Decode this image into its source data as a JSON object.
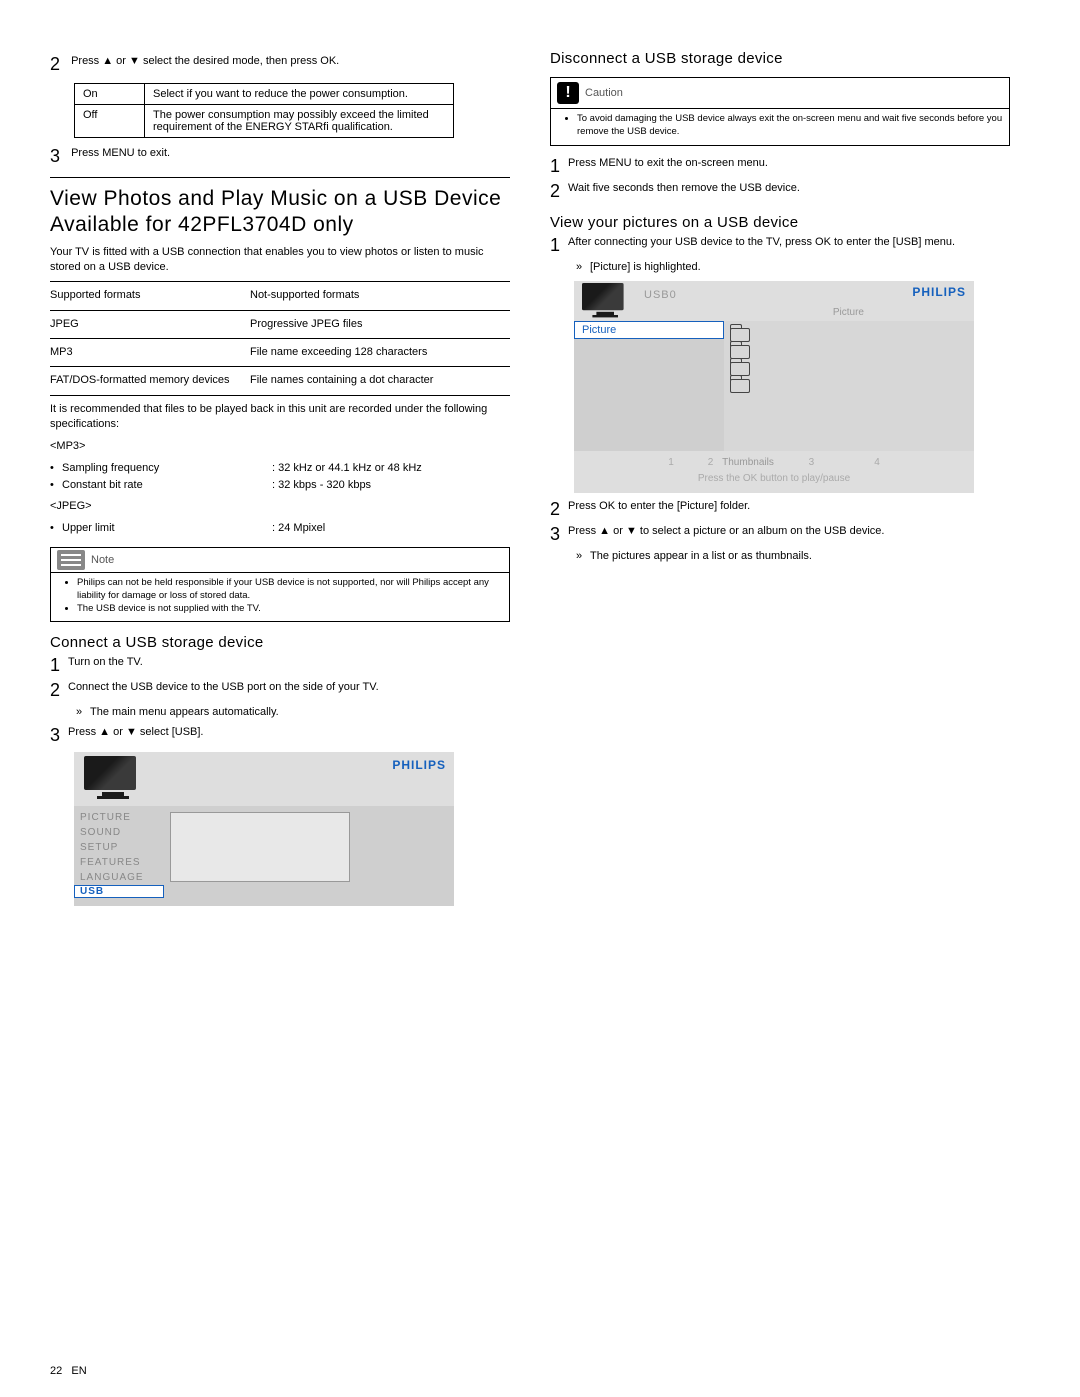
{
  "left": {
    "step2": "Press ▲ or ▼ select the desired mode, then press OK.",
    "table": {
      "r1c1": "On",
      "r1c2": "Select if you want to reduce the power consumption.",
      "r2c1": "Off",
      "r2c2": "The power consumption may possibly exceed the limited requirement of the ENERGY STARfi qualification."
    },
    "step3": "Press MENU to exit.",
    "h2a": "View Photos and Play Music on a USB Device",
    "h2b": "Available for 42PFL3704D only",
    "intro": "Your TV is ﬁtted with a USB connection that enables you to view photos or listen to music stored on a USB device.",
    "fmtHead1": "Supported formats",
    "fmtHead2": "Not-supported formats",
    "fmt1a": "JPEG",
    "fmt1b": "Progressive JPEG ﬁles",
    "fmt2a": "MP3",
    "fmt2b": "File name exceeding 128 characters",
    "fmt3a": "FAT/DOS-formatted memory devices",
    "fmt3b": "File names containing a dot character",
    "reco": "It is recommended that ﬁles to be played back in this unit are recorded under the following speciﬁcations:",
    "mp3": "<MP3>",
    "s1k": "Sampling frequency",
    "s1v": ": 32 kHz or 44.1 kHz or 48 kHz",
    "s2k": "Constant bit rate",
    "s2v": ": 32 kbps - 320 kbps",
    "jpeg": "<JPEG>",
    "s3k": "Upper limit",
    "s3v": ": 24 Mpixel",
    "noteTitle": "Note",
    "noteItem1": "Philips can not be held responsible if your USB device is not supported, nor will Philips accept any liability for damage or loss of stored data.",
    "noteItem2": "The USB device is not supplied with the TV.",
    "connectH": "Connect a USB storage device",
    "c1": "Turn on the TV.",
    "c2": "Connect the USB device to the USB port on the side of your TV.",
    "c2sub": "The main menu appears automatically.",
    "c3": "Press ▲ or ▼ select [USB].",
    "menu": {
      "items": [
        "PICTURE",
        "SOUND",
        "SETUP",
        "FEATURES",
        "LANGUAGE",
        "USB"
      ],
      "logo": "PHILIPS"
    }
  },
  "right": {
    "discH": "Disconnect a USB storage device",
    "cautionTitle": "Caution",
    "cautionBody": "To avoid damaging the USB device always exit the on-screen menu and wait ﬁve seconds before you remove the USB device.",
    "d1": "Press MENU to exit the on-screen menu.",
    "d2": "Wait ﬁve seconds then remove the USB device.",
    "viewH": "View your pictures on a USB device",
    "v1": "After connecting your USB device to the TV, press OK to enter the [USB] menu.",
    "v1sub": "[Picture] is highlighted.",
    "usb": {
      "title": "USB0",
      "sel": "Picture",
      "paneLabel": "Picture",
      "footNav": "Thumbnails",
      "footHint": "Press the OK button to play/pause",
      "logo": "PHILIPS"
    },
    "v2": "Press OK to enter the [Picture] folder.",
    "v3": "Press ▲ or ▼ to select a picture or an album on the USB device.",
    "v3sub": "The pictures appear in a list or as thumbnails."
  },
  "footer": {
    "page": "22",
    "lang": "EN"
  }
}
